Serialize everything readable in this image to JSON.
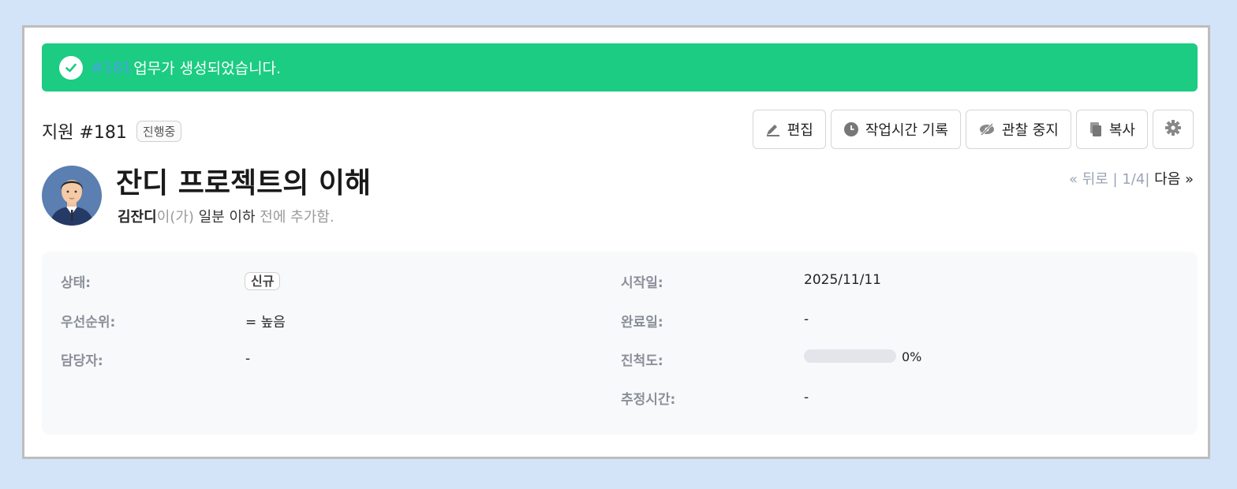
{
  "flash": {
    "issue_link": "#181",
    "message": "업무가 생성되었습니다."
  },
  "issue": {
    "tracker_id": "지원 #181",
    "status_tag": "진행중",
    "title": "잔디 프로젝트의 이해",
    "author": "김잔디",
    "author_suffix": "이(가)",
    "time_ago": "일분 이하",
    "added_text": "전에 추가함."
  },
  "actions": {
    "edit": "편집",
    "log_time": "작업시간 기록",
    "unwatch": "관찰 중지",
    "copy": "복사",
    "settings_icon": "gear-icon"
  },
  "pager": {
    "prev": "« 뒤로",
    "sep1": "|",
    "position": "1/4",
    "sep2": "|",
    "next": "다음 »"
  },
  "attributes": {
    "status_label": "상태:",
    "status_value": "신규",
    "priority_label": "우선순위:",
    "priority_value": "= 높음",
    "assignee_label": "담당자:",
    "assignee_value": "-",
    "start_label": "시작일:",
    "start_value": "2025/11/11",
    "due_label": "완료일:",
    "due_value": "-",
    "progress_label": "진척도:",
    "progress_value": "0%",
    "progress_fraction": 0,
    "estimate_label": "추정시간:",
    "estimate_value": "-"
  },
  "colors": {
    "flash_bg": "#1bcc82",
    "link": "#4aa3e8",
    "page_bg": "#d3e3f8"
  }
}
